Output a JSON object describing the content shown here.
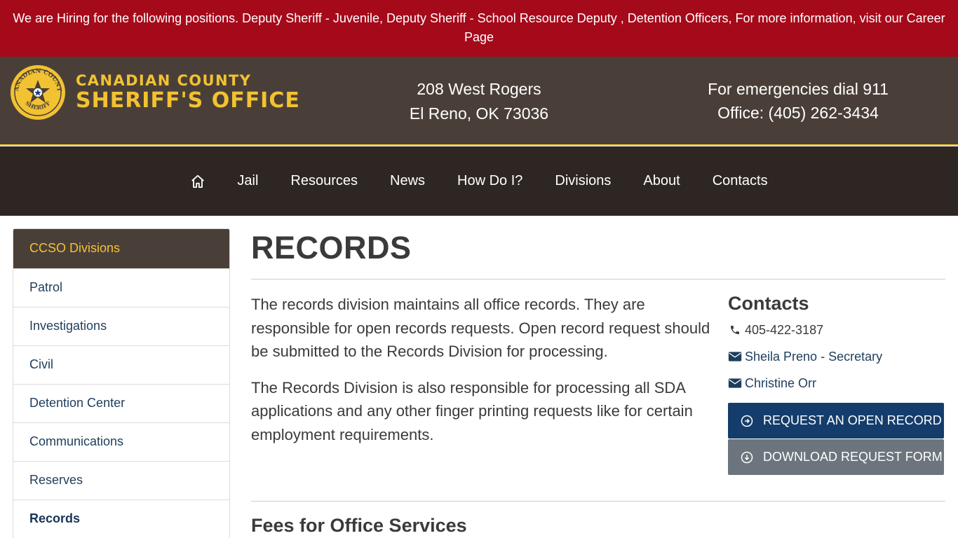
{
  "alert": {
    "text": "We are Hiring for the following positions. Deputy Sheriff - Juvenile, Deputy Sheriff - School Resource Deputy , Detention Officers, For more information, visit our Career Page"
  },
  "header": {
    "logo": {
      "seal_text_top": "CANADIAN COUNTY",
      "seal_text_bottom": "SHERIFF",
      "line1": "CANADIAN COUNTY",
      "line2": "SHERIFF'S OFFICE",
      "brand_color": "#f2c232"
    },
    "address": {
      "line1": "208 West Rogers",
      "line2": "El Reno, OK 73036"
    },
    "emergency": {
      "line1": "For emergencies dial 911",
      "line2": "Office: (405) 262-3434"
    }
  },
  "nav": {
    "home_icon": "home-icon",
    "items": [
      "Jail",
      "Resources",
      "News",
      "How Do I?",
      "Divisions",
      "About",
      "Contacts"
    ]
  },
  "sidebar": {
    "title": "CCSO Divisions",
    "items": [
      {
        "label": "Patrol"
      },
      {
        "label": "Investigations"
      },
      {
        "label": "Civil"
      },
      {
        "label": "Detention Center"
      },
      {
        "label": "Communications"
      },
      {
        "label": "Reserves"
      },
      {
        "label": "Records"
      }
    ],
    "active": "Records"
  },
  "main": {
    "title": "RECORDS",
    "paragraphs": [
      "The records division maintains all office records. They are responsible for open records requests. Open record request should be submitted to the Records Division for processing.",
      "The Records Division is also responsible for processing all SDA applications and any other finger printing requests like for certain employment requirements."
    ],
    "contacts": {
      "title": "Contacts",
      "phone": "405-422-3187",
      "email1": "Sheila Preno - Secretary",
      "email2": "Christine Orr",
      "button_request": "REQUEST AN OPEN RECORD",
      "button_download": "DOWNLOAD REQUEST FORM"
    },
    "section_title": "Fees for Office Services"
  },
  "colors": {
    "alert_bg": "#a50a1b",
    "header_bg": "#4a3f38",
    "nav_bg": "#2e2622",
    "accent": "#f2c232",
    "primary_button": "#143d6b",
    "secondary_button": "#6c757d"
  }
}
